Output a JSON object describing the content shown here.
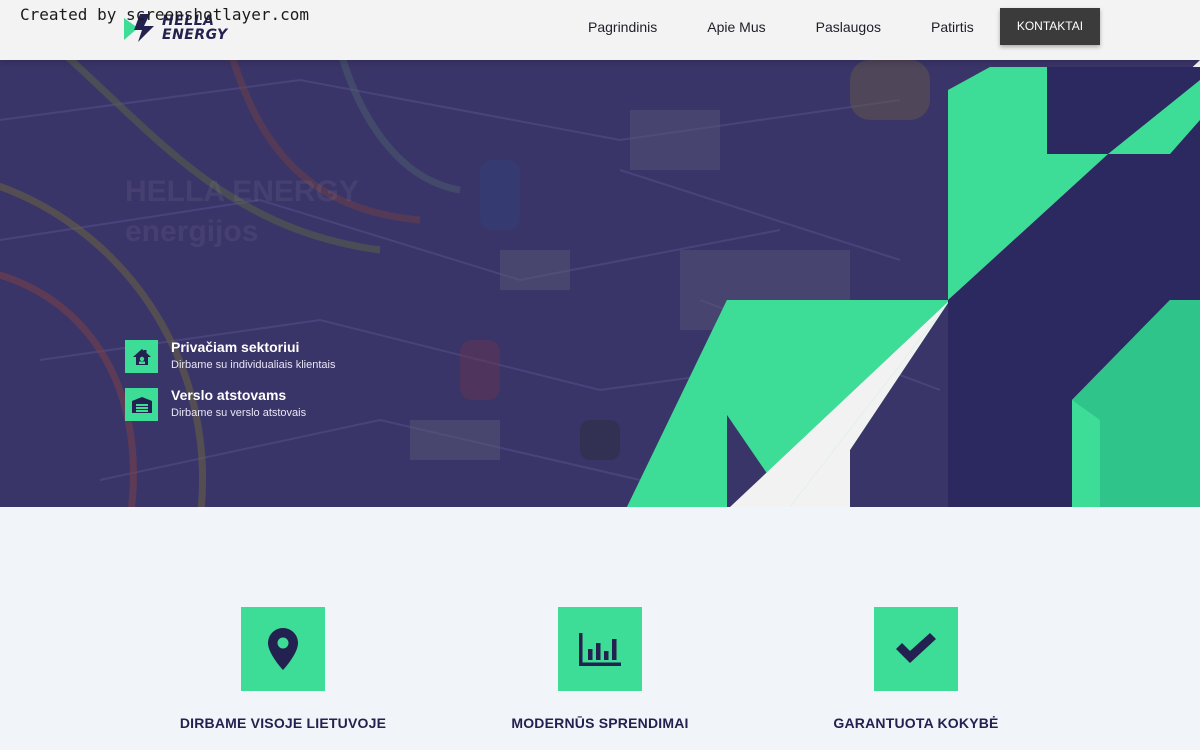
{
  "watermark": "Created by screenshotlayer.com",
  "brand": {
    "line1": "HELLA",
    "line2": "ENERGY",
    "colors": {
      "primary": "#23214f",
      "accent": "#3ddc97",
      "nav_button": "#3b3b3b"
    }
  },
  "nav": {
    "items": [
      {
        "label": "Pagrindinis"
      },
      {
        "label": "Apie Mus"
      },
      {
        "label": "Paslaugos"
      },
      {
        "label": "Patirtis"
      }
    ],
    "cta": "KONTAKTAI"
  },
  "hero": {
    "faded_heading": [
      "HELLA ENERGY",
      "energijos"
    ],
    "items": [
      {
        "title": "Privačiam sektoriui",
        "subtitle": "Dirbame su individualiais klientais",
        "icon": "house-icon"
      },
      {
        "title": "Verslo atstovams",
        "subtitle": "Dirbame su verslo atstovais",
        "icon": "warehouse-icon"
      }
    ]
  },
  "features": [
    {
      "title": "DIRBAME VISOJE LIETUVOJE",
      "icon": "map-pin-icon"
    },
    {
      "title": "MODERNŪS SPRENDIMAI",
      "icon": "bar-chart-icon"
    },
    {
      "title": "GARANTUOTA KOKYBĖ",
      "icon": "checkmark-icon"
    }
  ]
}
